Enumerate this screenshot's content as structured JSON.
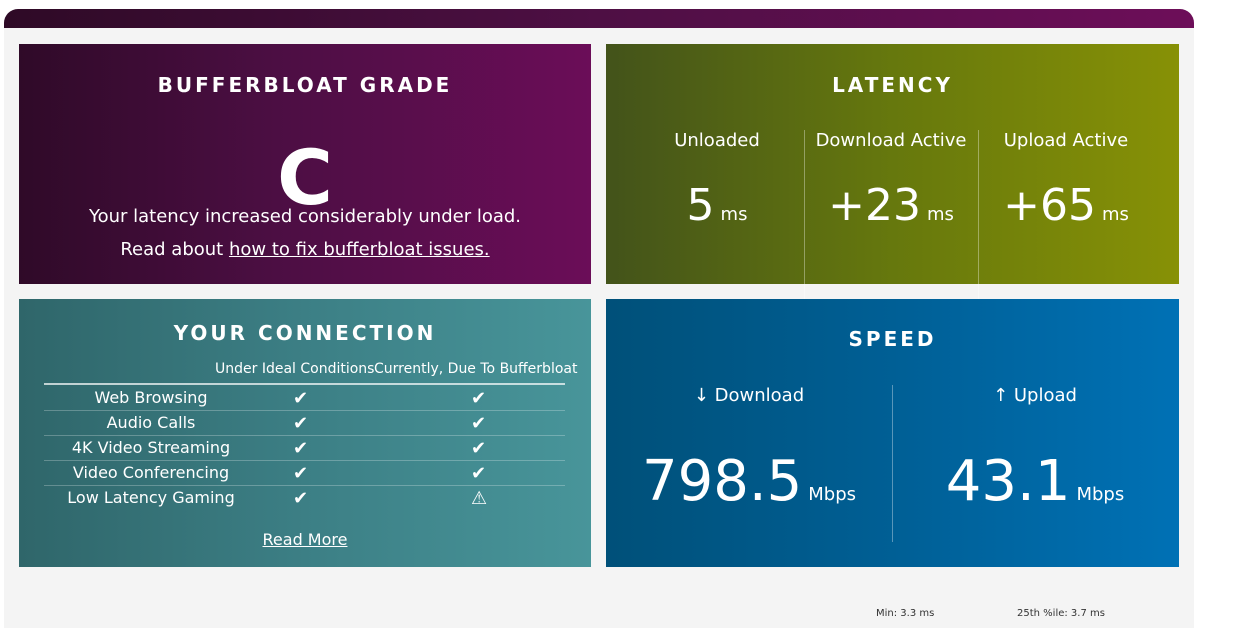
{
  "grade": {
    "title": "BUFFERBLOAT GRADE",
    "letter": "C",
    "description": "Your latency increased considerably under load.",
    "read_prefix": "Read about ",
    "read_link": "how to fix bufferbloat issues."
  },
  "latency": {
    "title": "LATENCY",
    "columns": [
      {
        "label": "Unloaded",
        "value": "5",
        "unit": "ms"
      },
      {
        "label": "Download Active",
        "value": "+23",
        "unit": "ms"
      },
      {
        "label": "Upload Active",
        "value": "+65",
        "unit": "ms"
      }
    ]
  },
  "connection": {
    "title": "YOUR CONNECTION",
    "col_ideal": "Under Ideal Conditions",
    "col_current": "Currently, Due To Bufferbloat",
    "rows": [
      {
        "name": "Web Browsing",
        "ideal": "✔",
        "current": "✔"
      },
      {
        "name": "Audio Calls",
        "ideal": "✔",
        "current": "✔"
      },
      {
        "name": "4K Video Streaming",
        "ideal": "✔",
        "current": "✔"
      },
      {
        "name": "Video Conferencing",
        "ideal": "✔",
        "current": "✔"
      },
      {
        "name": "Low Latency Gaming",
        "ideal": "✔",
        "current": "⚠"
      }
    ],
    "read_more": "Read More"
  },
  "speed": {
    "title": "SPEED",
    "download": {
      "label": "↓ Download",
      "value": "798.5",
      "unit": "Mbps"
    },
    "upload": {
      "label": "↑ Upload",
      "value": "43.1",
      "unit": "Mbps"
    }
  },
  "footer": {
    "min": "Min: 3.3 ms",
    "p25": "25th %ile: 3.7 ms"
  }
}
